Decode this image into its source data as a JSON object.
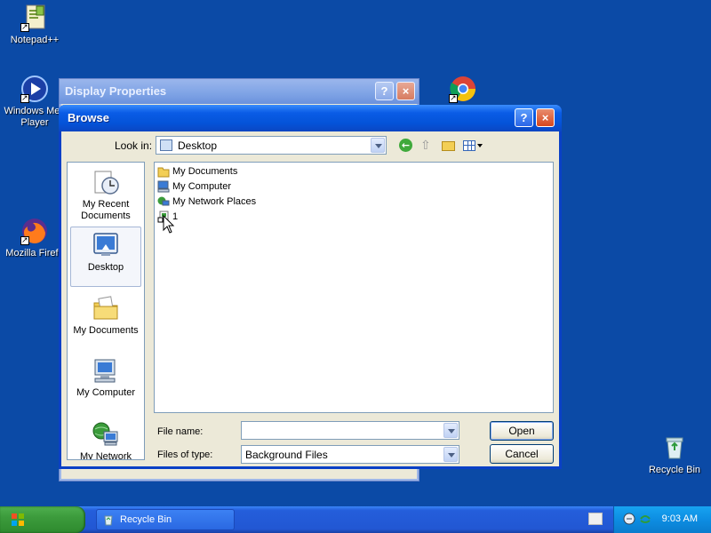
{
  "desktop": {
    "icons": [
      {
        "label": "Notepad++"
      },
      {
        "label": "Windows Media Player",
        "line1": "Windows Med",
        "line2": "Player"
      },
      {
        "label": "Mozilla Firefox",
        "display": "Mozilla Firefo"
      },
      {
        "label": "Recycle Bin"
      }
    ]
  },
  "bg_window": {
    "title": "Display Properties",
    "help": "?",
    "close": "×"
  },
  "dialog": {
    "title": "Browse",
    "help": "?",
    "close": "×",
    "look_in_label": "Look in:",
    "look_in_value": "Desktop",
    "places": [
      {
        "label": "My Recent Documents",
        "line1": "My Recent",
        "line2": "Documents",
        "icon": "recent-documents-icon"
      },
      {
        "label": "Desktop",
        "icon": "desktop-icon",
        "selected": true
      },
      {
        "label": "My Documents",
        "icon": "my-documents-icon"
      },
      {
        "label": "My Computer",
        "icon": "my-computer-icon"
      },
      {
        "label": "My Network",
        "icon": "my-network-icon"
      }
    ],
    "files": [
      {
        "name": "My Documents",
        "icon": "folder-icon"
      },
      {
        "name": "My Computer",
        "icon": "computer-icon"
      },
      {
        "name": "My Network Places",
        "icon": "network-icon"
      },
      {
        "name": "1",
        "icon": "shortcut-icon"
      }
    ],
    "file_name_label": "File name:",
    "file_name_value": "",
    "file_type_label": "Files of type:",
    "file_type_value": "Background Files",
    "open_label": "Open",
    "cancel_label": "Cancel"
  },
  "taskbar": {
    "task_label": "Recycle Bin",
    "clock": "9:03 AM"
  },
  "colors": {
    "desktop": "#0b4aa6",
    "titlebar": "#0a5ce6",
    "start": "#3c9b3c",
    "tray": "#0d8de2"
  }
}
